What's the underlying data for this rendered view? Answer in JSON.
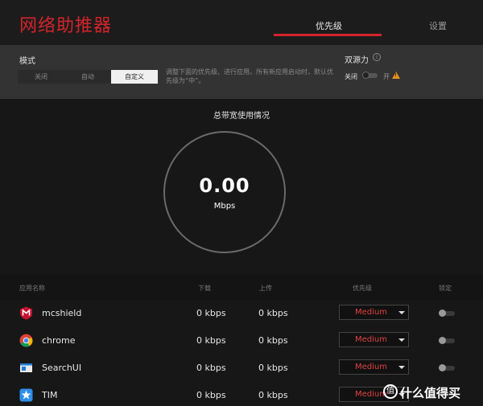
{
  "header": {
    "title": "网络助推器",
    "tabs": [
      {
        "label": "优先级",
        "active": true
      },
      {
        "label": "设置",
        "active": false
      }
    ]
  },
  "mode": {
    "label": "模式",
    "options": [
      "关闭",
      "自动",
      "自定义"
    ],
    "selected": "自定义",
    "description": "调整下面的优先级、进行应用。所有新应用启动时，默认优先级为“中”。"
  },
  "dual_source": {
    "label": "双源力",
    "off_label": "关闭",
    "on_label": "开",
    "enabled": false
  },
  "bandwidth": {
    "title": "总带宽使用情况",
    "value": "0.00",
    "unit": "Mbps"
  },
  "table": {
    "columns": [
      "应用名称",
      "下载",
      "上传",
      "优先级",
      "锁定"
    ],
    "rows": [
      {
        "name": "mcshield",
        "icon": "mcafee-icon",
        "download": "0 kbps",
        "upload": "0 kbps",
        "priority": "Medium",
        "locked": false
      },
      {
        "name": "chrome",
        "icon": "chrome-icon",
        "download": "0 kbps",
        "upload": "0 kbps",
        "priority": "Medium",
        "locked": false
      },
      {
        "name": "SearchUI",
        "icon": "searchui-icon",
        "download": "0 kbps",
        "upload": "0 kbps",
        "priority": "Medium",
        "locked": false
      },
      {
        "name": "TIM",
        "icon": "tim-icon",
        "download": "0 kbps",
        "upload": "0 kbps",
        "priority": "Medium",
        "locked": false
      }
    ]
  },
  "watermark": {
    "badge": "值",
    "text": "什么值得买"
  },
  "colors": {
    "accent": "#d3242b",
    "priority_text": "#e04242",
    "warning": "#e8901c"
  }
}
